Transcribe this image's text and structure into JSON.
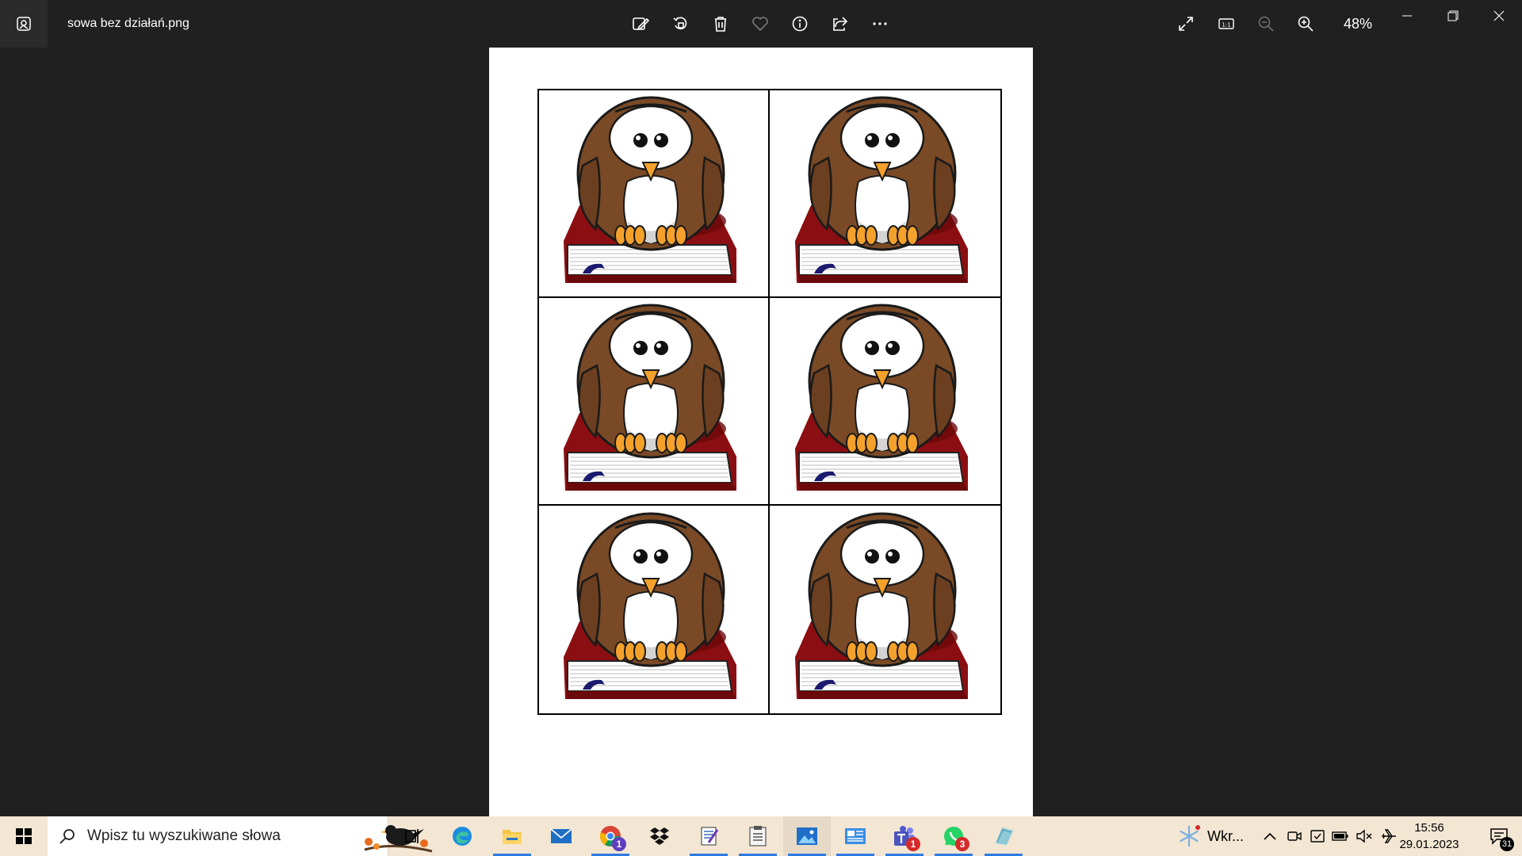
{
  "window": {
    "title": "sowa bez działań.png",
    "zoom": "48%"
  },
  "toolbar": {
    "items": [
      "edit-image-icon",
      "rotate-icon",
      "delete-icon",
      "favorite-icon",
      "info-icon",
      "share-icon",
      "more-icon"
    ]
  },
  "viewbar": {
    "items": [
      "fullscreen-icon",
      "actual-size-icon",
      "zoom-out-icon",
      "zoom-in-icon"
    ]
  },
  "image": {
    "rows": 3,
    "columns": 2,
    "tile": "owl-on-book",
    "colors": {
      "owl": "#7a4a26",
      "book": "#8b0f12",
      "beak": "#f4a12b",
      "bookmark": "#1a1a6e"
    }
  },
  "taskbar": {
    "search_placeholder": "Wpisz tu wyszukiwane słowa",
    "apps": [
      "task-view",
      "edge",
      "file-explorer",
      "mail",
      "chrome",
      "dropbox",
      "notepad-editor",
      "notes",
      "photos",
      "news",
      "teams",
      "whatsapp",
      "edu-app"
    ],
    "badges": {
      "chrome": "1",
      "teams": "1",
      "whatsapp": "3"
    },
    "weather": "Wkr...",
    "time": "15:56",
    "date": "29.01.2023",
    "notification_count": "31"
  }
}
